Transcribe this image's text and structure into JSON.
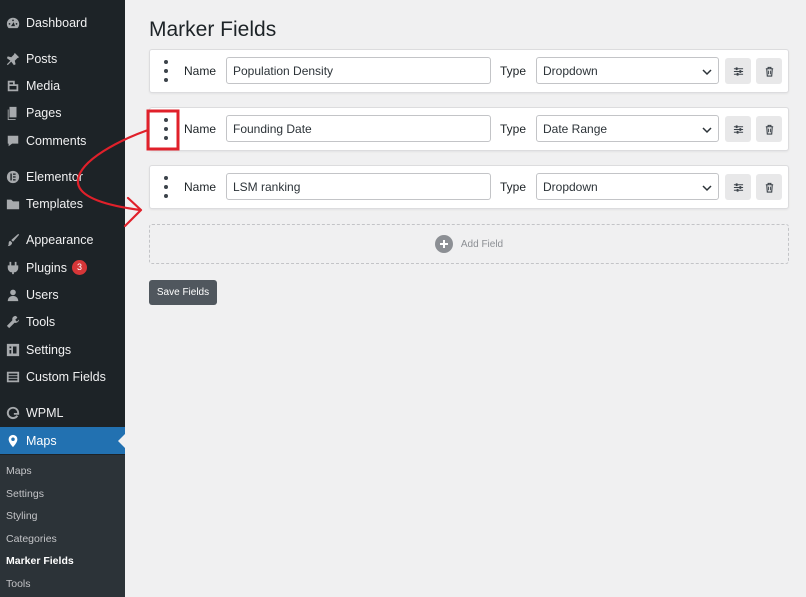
{
  "sidebar": {
    "items": [
      {
        "label": "Dashboard",
        "icon": "dashboard-icon"
      },
      {
        "label": "Posts",
        "icon": "pin-icon"
      },
      {
        "label": "Media",
        "icon": "media-icon"
      },
      {
        "label": "Pages",
        "icon": "pages-icon"
      },
      {
        "label": "Comments",
        "icon": "comments-icon"
      },
      {
        "label": "Elementor",
        "icon": "elementor-icon"
      },
      {
        "label": "Templates",
        "icon": "folder-icon"
      },
      {
        "label": "Appearance",
        "icon": "brush-icon"
      },
      {
        "label": "Plugins",
        "icon": "plugins-icon",
        "badge": "3"
      },
      {
        "label": "Users",
        "icon": "users-icon"
      },
      {
        "label": "Tools",
        "icon": "wrench-icon"
      },
      {
        "label": "Settings",
        "icon": "settings-icon"
      },
      {
        "label": "Custom Fields",
        "icon": "grid-icon"
      },
      {
        "label": "WPML",
        "icon": "wpml-icon"
      },
      {
        "label": "Maps",
        "icon": "location-pin-icon",
        "active": true
      }
    ],
    "submenu": [
      "Maps",
      "Settings",
      "Styling",
      "Categories",
      "Marker Fields",
      "Tools"
    ],
    "submenu_current": "Marker Fields"
  },
  "main": {
    "title": "Marker Fields",
    "name_label": "Name",
    "type_label": "Type",
    "fields": [
      {
        "name": "Population Density",
        "type": "Dropdown"
      },
      {
        "name": "Founding Date",
        "type": "Date Range"
      },
      {
        "name": "LSM ranking",
        "type": "Dropdown"
      }
    ],
    "add_field_label": "Add Field",
    "save_label": "Save Fields"
  },
  "colors": {
    "sidebar_bg": "#1d2327",
    "active": "#2271b1",
    "annotation": "#e0202a"
  }
}
